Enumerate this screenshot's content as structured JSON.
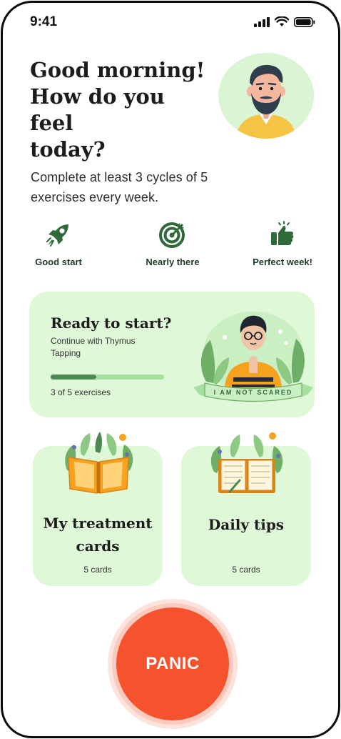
{
  "status_bar": {
    "time": "9:41"
  },
  "greeting": {
    "line1": "Good morning!",
    "line2": "How do you feel",
    "line3": "today?"
  },
  "goal": {
    "text": "Complete at least 3 cycles of 5 exercises every week."
  },
  "achievements": [
    {
      "icon": "rocket-icon",
      "label": "Good start"
    },
    {
      "icon": "target-icon",
      "label": "Nearly there"
    },
    {
      "icon": "thumbs-up-icon",
      "label": "Perfect week!"
    }
  ],
  "ready_card": {
    "title": "Ready to start?",
    "subtitle": "Continue with Thymus Tapping",
    "progress": 0.4,
    "progress_text": "3 of 5 exercises",
    "banner_text": "I AM NOT SCARED"
  },
  "tiles": [
    {
      "title_line1": "My treatment",
      "title_line2": "cards",
      "count": "5 cards",
      "icon": "open-book-icon"
    },
    {
      "title_line1": "Daily tips",
      "count": "5 cards",
      "icon": "notebook-icon"
    }
  ],
  "panic": {
    "label": "PANIC"
  },
  "colors": {
    "accent_green": "#4a8a52",
    "card_green": "#dff8d8",
    "panic_red": "#f5532e",
    "icon_green": "#2f6b3a"
  }
}
